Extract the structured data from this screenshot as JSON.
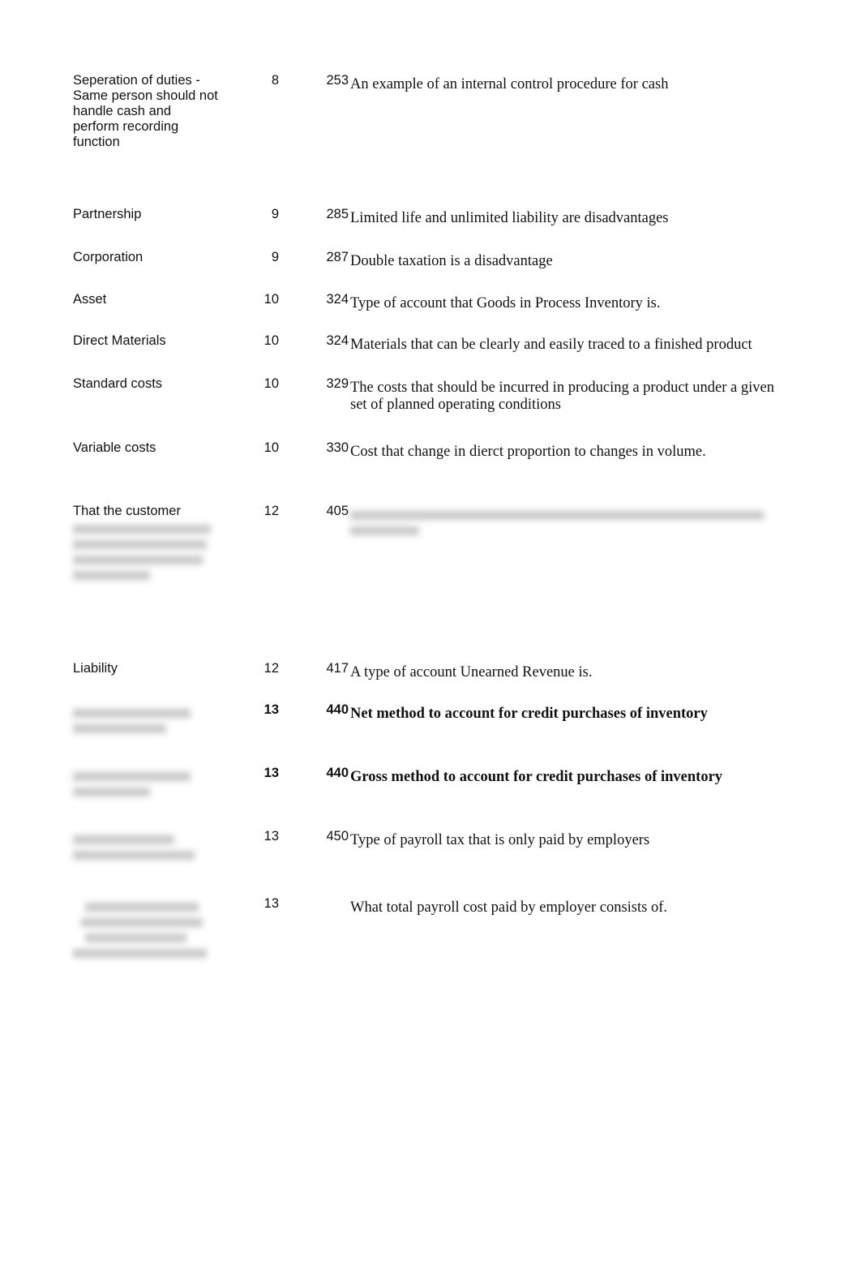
{
  "rows": [
    {
      "term": "Seperation of duties - Same person should not handle cash and perform recording function",
      "chapter": "8",
      "page": "253",
      "description": "An example of an internal control procedure for cash"
    },
    {
      "term": "Partnership",
      "chapter": "9",
      "page": "285",
      "description": "Limited life and unlimited liability are disadvantages"
    },
    {
      "term": "Corporation",
      "chapter": "9",
      "page": "287",
      "description": "Double taxation is a disadvantage"
    },
    {
      "term": "Asset",
      "chapter": "10",
      "page": "324",
      "description": "Type of account that Goods in Process Inventory is."
    },
    {
      "term": "Direct Materials",
      "chapter": "10",
      "page": "324",
      "description": "Materials that can be clearly and easily traced to a finished product"
    },
    {
      "term": "Standard costs",
      "chapter": "10",
      "page": "329",
      "description": "The costs that should be incurred in producing a product under a given set of planned operating conditions"
    },
    {
      "term": "Variable costs",
      "chapter": "10",
      "page": "330",
      "description": "Cost that change in dierct proportion to changes in volume."
    },
    {
      "term": "That the customer",
      "chapter": "12",
      "page": "405",
      "description": ""
    },
    {
      "term": "Liability",
      "chapter": "12",
      "page": "417",
      "description": "A type of account Unearned Revenue is."
    },
    {
      "term": "",
      "chapter": "13",
      "page": "440",
      "description": "Net method to account for credit purchases of inventory"
    },
    {
      "term": "",
      "chapter": "13",
      "page": "440",
      "description": "Gross method to account for credit purchases of inventory"
    },
    {
      "term": "",
      "chapter": "13",
      "page": "450",
      "description": "Type of payroll tax that is only paid by employers"
    },
    {
      "term": "",
      "chapter": "13",
      "page": "",
      "description": "What total payroll cost paid by employer consists of."
    }
  ]
}
